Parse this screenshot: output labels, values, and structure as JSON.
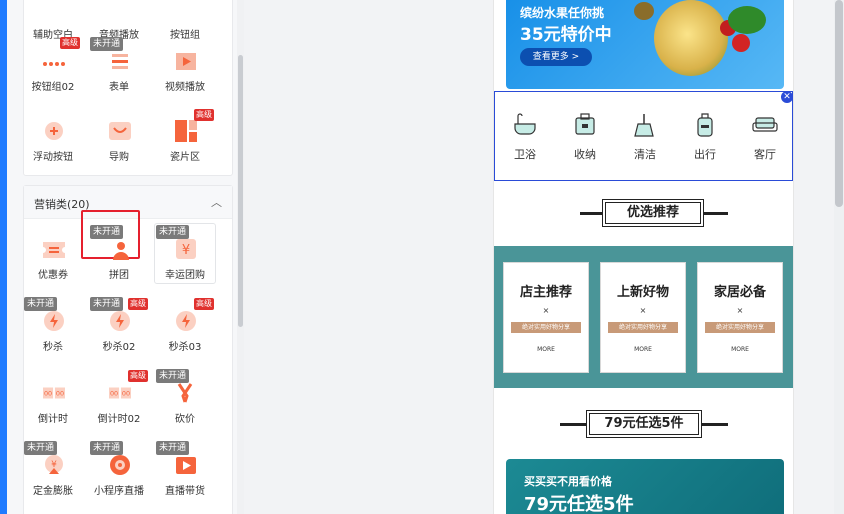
{
  "left_panel": {
    "top_items": [
      {
        "label": "辅助空白",
        "icon": "blank-icon"
      },
      {
        "label": "音频播放",
        "icon": "audio-icon"
      },
      {
        "label": "按钮组",
        "icon": "button-group-icon"
      },
      {
        "label": "按钮组02",
        "icon": "dots-icon",
        "badge_red": "高级"
      },
      {
        "label": "表单",
        "icon": "form-icon",
        "badge_gray": "未开通"
      },
      {
        "label": "视频播放",
        "icon": "video-icon"
      },
      {
        "label": "浮动按钮",
        "icon": "float-plus-icon"
      },
      {
        "label": "导购",
        "icon": "smile-icon"
      },
      {
        "label": "瓷片区",
        "icon": "tiles-icon",
        "badge_red": "高级"
      }
    ],
    "marketing": {
      "title": "营销类(20)",
      "collapse_icon": "chevron-up-icon",
      "items": [
        {
          "label": "优惠券",
          "icon": "coupon-icon"
        },
        {
          "label": "拼团",
          "icon": "group-buy-icon",
          "badge_gray": "未开通",
          "selected": true
        },
        {
          "label": "幸运团购",
          "icon": "lucky-group-icon",
          "badge_gray": "未开通"
        },
        {
          "label": "秒杀",
          "icon": "flash-icon",
          "badge_gray": "未开通"
        },
        {
          "label": "秒杀02",
          "icon": "flash-icon",
          "badge_gray": "未开通",
          "badge_red": "高级"
        },
        {
          "label": "秒杀03",
          "icon": "flash-icon",
          "badge_red": "高级"
        },
        {
          "label": "倒计时",
          "icon": "countdown-icon"
        },
        {
          "label": "倒计时02",
          "icon": "countdown-icon",
          "badge_red": "高级"
        },
        {
          "label": "砍价",
          "icon": "bargain-icon",
          "badge_gray": "未开通"
        },
        {
          "label": "定金膨胀",
          "icon": "deposit-icon",
          "badge_gray": "未开通"
        },
        {
          "label": "小程序直播",
          "icon": "live-icon",
          "badge_gray": "未开通"
        },
        {
          "label": "直播带货",
          "icon": "live-play-icon",
          "badge_gray": "未开通"
        }
      ]
    }
  },
  "preview": {
    "banner": {
      "line1": "缤纷水果任你挑",
      "line2": "35元特价中",
      "button": "查看更多 >"
    },
    "nav": [
      {
        "label": "卫浴",
        "icon": "bathtub-icon"
      },
      {
        "label": "收纳",
        "icon": "storage-icon"
      },
      {
        "label": "清洁",
        "icon": "broom-icon"
      },
      {
        "label": "出行",
        "icon": "luggage-icon"
      },
      {
        "label": "客厅",
        "icon": "sofa-icon"
      }
    ],
    "close_symbol": "✕",
    "section1_title": "优选推荐",
    "cards": [
      {
        "title": "店主推荐",
        "x": "×",
        "sub": "绝对实用好物分享",
        "more": "MORE"
      },
      {
        "title": "上新好物",
        "x": "×",
        "sub": "绝对实用好物分享",
        "more": "MORE"
      },
      {
        "title": "家居必备",
        "x": "×",
        "sub": "绝对实用好物分享",
        "more": "MORE"
      }
    ],
    "section2_title": "79元任选5件",
    "bottom_banner": {
      "line1": "买买买不用看价格",
      "line2": "79元任选5件"
    }
  },
  "colors": {
    "accent": "#1f7bff",
    "orange": "#f5643c",
    "teal": "#4a9598",
    "badge_red": "#e0312e",
    "select_red": "#e5202e"
  }
}
